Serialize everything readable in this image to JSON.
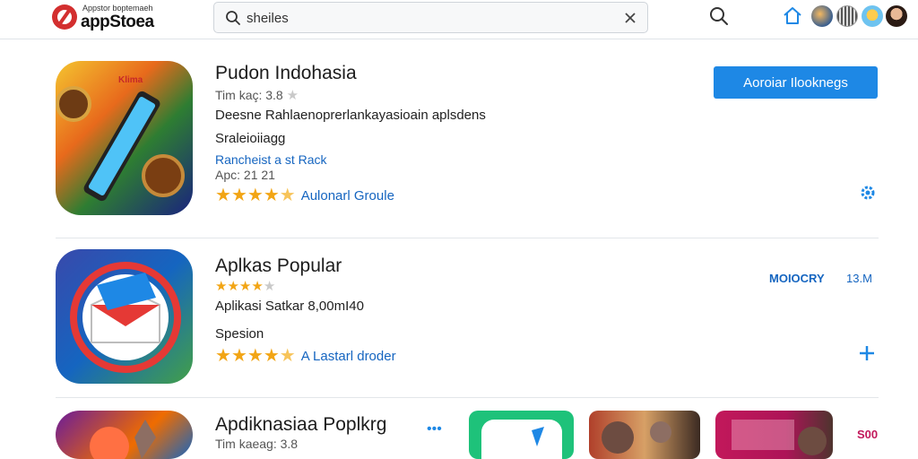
{
  "header": {
    "logo_small": "Appstor boptemaeh",
    "logo_big": "appStoea",
    "search_value": "sheiles",
    "colors": {
      "logo_red": "#d32f2f",
      "accent_blue": "#1e88e5"
    }
  },
  "apps": [
    {
      "title": "Pudon Indohasia",
      "rating_line": "Tim kaç: 3.8",
      "description": "Deesne Rahlaenoprerlankayasioain aplsdens",
      "category": "Sraleioiiagg",
      "rank_link": "Rancheist a st Rack",
      "date": "Apc: 21 21",
      "rating_stars": 4.5,
      "review_link": "Aulonarl Groule",
      "cta_label": "Aoroiar Ilooknegs"
    },
    {
      "title": "Aplkas Popular",
      "rating_stars": 4,
      "detail": "Aplikasi Satkar 8,00mI40",
      "category": "Spesion",
      "rating_stars_2": 4.5,
      "review_link": "A Lastarl droder",
      "side_label": "MOIOCRY",
      "size": "13.M"
    },
    {
      "title": "Apdiknasiaa Poplkrg",
      "rating_line": "Tim kaeag: 3.8",
      "more_label": "•••",
      "badge": "S00"
    }
  ]
}
